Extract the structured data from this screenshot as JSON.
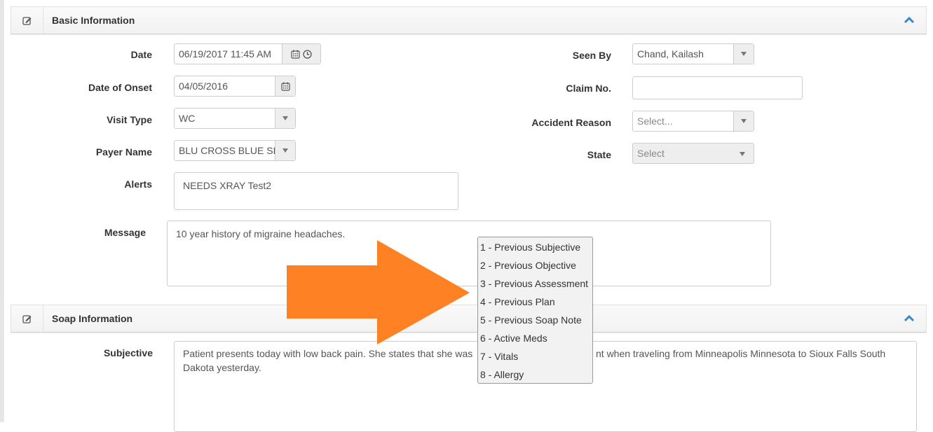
{
  "colors": {
    "accent": "#337ab7",
    "arrow": "#fe8124"
  },
  "sections": {
    "basic": {
      "title": "Basic Information",
      "icon": "edit-icon",
      "toggle_icon": "chevron-up-icon"
    },
    "soap": {
      "title": "Soap Information",
      "icon": "edit-icon",
      "toggle_icon": "chevron-up-icon"
    }
  },
  "basic_form": {
    "date": {
      "label": "Date",
      "value": "06/19/2017 11:45 AM"
    },
    "date_of_onset": {
      "label": "Date of Onset",
      "value": "04/05/2016"
    },
    "visit_type": {
      "label": "Visit Type",
      "value": "WC"
    },
    "payer_name": {
      "label": "Payer Name",
      "value": "BLU CROSS BLUE SH"
    },
    "alerts": {
      "label": "Alerts",
      "value": "NEEDS XRAY Test2"
    },
    "message": {
      "label": "Message",
      "value": "10 year history of migraine headaches."
    },
    "seen_by": {
      "label": "Seen By",
      "value": "Chand, Kailash"
    },
    "claim_no": {
      "label": "Claim No.",
      "value": ""
    },
    "accident_reason": {
      "label": "Accident Reason",
      "placeholder": "Select..."
    },
    "state": {
      "label": "State",
      "placeholder": "Select"
    }
  },
  "soap_form": {
    "subjective": {
      "label": "Subjective",
      "line1_left": "Patient presents today with low back pain. She states that she was",
      "line1_right": "nt when traveling from Minneapolis Minnesota to Sioux Falls South",
      "line2": "Dakota yesterday."
    }
  },
  "quick_insert_menu": {
    "options": [
      "1 - Previous Subjective",
      "2 - Previous Objective",
      "3 - Previous Assessment",
      "4 - Previous Plan",
      "5 - Previous Soap Note",
      "6 - Active Meds",
      "7 - Vitals",
      "8 - Allergy"
    ]
  },
  "annotation": {
    "type": "arrow",
    "direction": "right"
  }
}
